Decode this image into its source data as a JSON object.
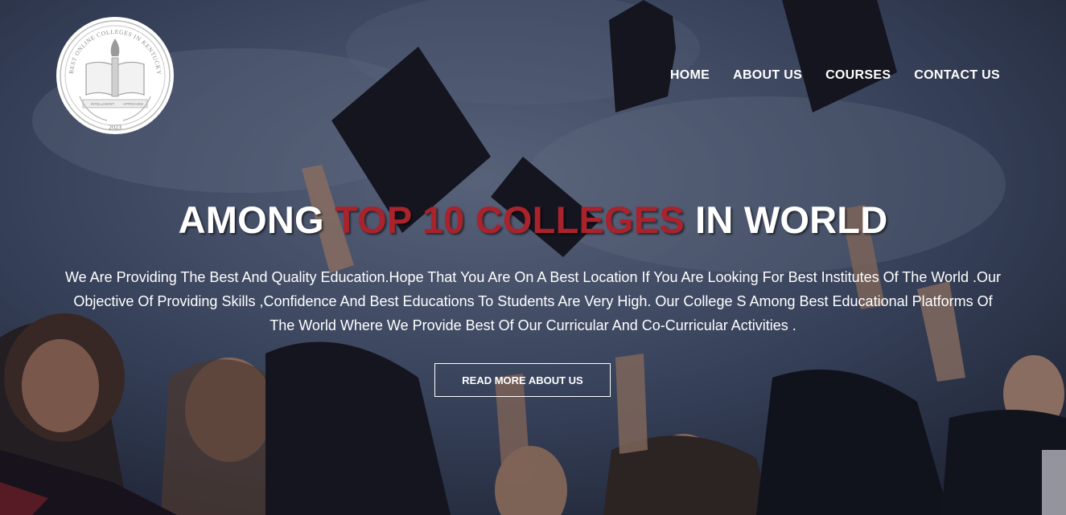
{
  "logo": {
    "arc_text": "BEST ONLINE COLLEGES IN KENTUCKY",
    "year": "2023",
    "ribbon_left": "INTELLIGENT",
    "ribbon_right": "APPROVED"
  },
  "nav": {
    "items": [
      "HOME",
      "ABOUT US",
      "COURSES",
      "CONTACT US"
    ]
  },
  "hero": {
    "headline_prefix": "AMONG ",
    "headline_accent": "TOP 10 COLLEGES",
    "headline_suffix": " IN WORLD",
    "description": "We Are Providing The Best And Quality Education.Hope That You Are On A Best Location If You Are Looking For Best Institutes Of The World .Our Objective Of Providing Skills ,Confidence And Best Educations To Students Are Very High. Our College S Among Best Educational Platforms Of The World Where We Provide Best Of Our Curricular And Co-Curricular Activities .",
    "cta_label": "READ MORE ABOUT US"
  },
  "colors": {
    "accent": "#a8232b",
    "text": "#ffffff"
  }
}
